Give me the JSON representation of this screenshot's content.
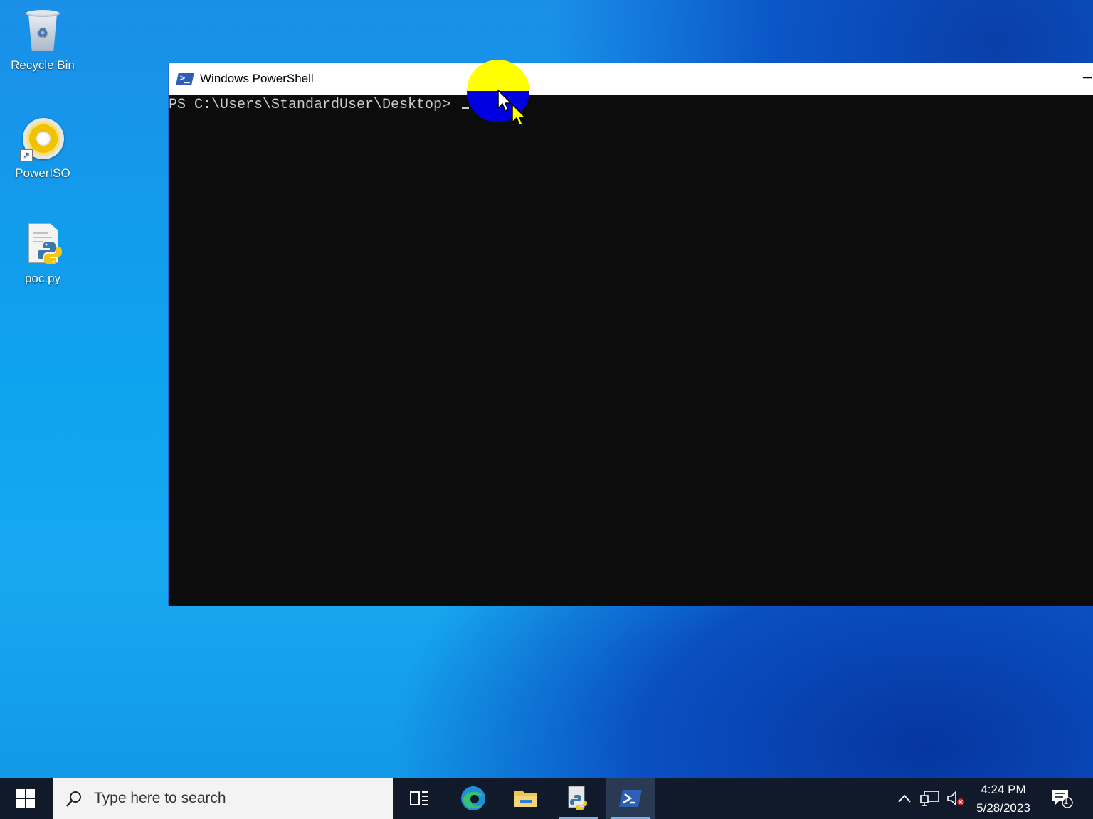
{
  "desktop": {
    "icons": [
      {
        "label": "Recycle Bin",
        "icon": "recycle-bin-icon"
      },
      {
        "label": "PowerISO",
        "icon": "poweriso-icon"
      },
      {
        "label": "poc.py",
        "icon": "python-file-icon"
      }
    ]
  },
  "powershell": {
    "title": "Windows PowerShell",
    "minimize_glyph": "─",
    "prompt": "PS C:\\Users\\StandardUser\\Desktop> "
  },
  "taskbar": {
    "search_placeholder": "Type here to search",
    "apps": [
      {
        "name": "Task View",
        "icon": "task-view-icon"
      },
      {
        "name": "Microsoft Edge",
        "icon": "edge-icon"
      },
      {
        "name": "File Explorer",
        "icon": "file-explorer-icon"
      },
      {
        "name": "Python",
        "icon": "python-icon"
      },
      {
        "name": "Windows PowerShell",
        "icon": "powershell-icon",
        "active": true
      }
    ],
    "clock": {
      "time": "4:24 PM",
      "date": "5/28/2023"
    },
    "notifications_count": "1"
  },
  "colors": {
    "console_bg": "#0c0c0c",
    "console_fg": "#cccccc",
    "taskbar_bg": "#101a2a",
    "highlight_top": "#ffff00",
    "highlight_bottom": "#0000e0"
  }
}
